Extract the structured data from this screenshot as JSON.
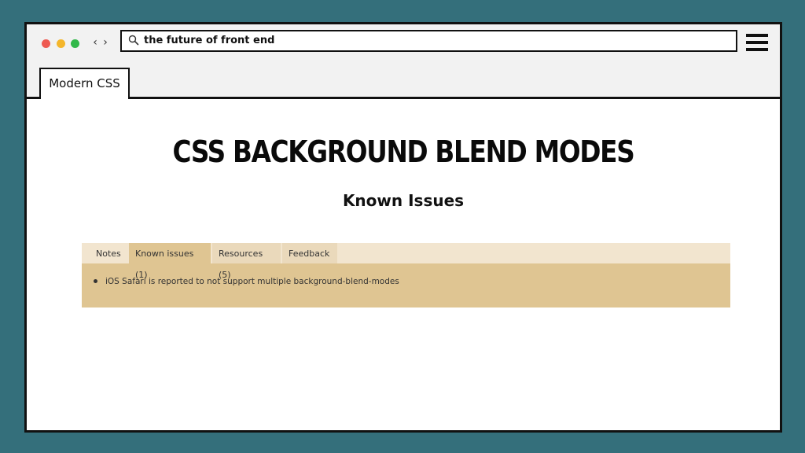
{
  "browser": {
    "address_bar": {
      "value": "the future of front end",
      "search_icon": "search-icon"
    },
    "controls": {
      "back_glyph": "‹",
      "forward_glyph": "›",
      "menu_icon": "hamburger-menu-icon"
    },
    "tab": {
      "label": "Modern CSS"
    }
  },
  "page": {
    "title": "CSS BACKGROUND BLEND MODES",
    "subtitle": "Known Issues"
  },
  "caniuse_panel": {
    "tabs": [
      {
        "label": "Notes"
      },
      {
        "label": "Known issues (1)"
      },
      {
        "label": "Resources (5)"
      },
      {
        "label": "Feedback"
      }
    ],
    "active_tab": "Known issues (1)",
    "issues": [
      "iOS Safari is reported to not support multiple background-blend-modes"
    ]
  },
  "colors": {
    "backdrop": "#346f7b",
    "panel_background": "#dfc592",
    "tabstrip_background": "#f2e5cf"
  }
}
